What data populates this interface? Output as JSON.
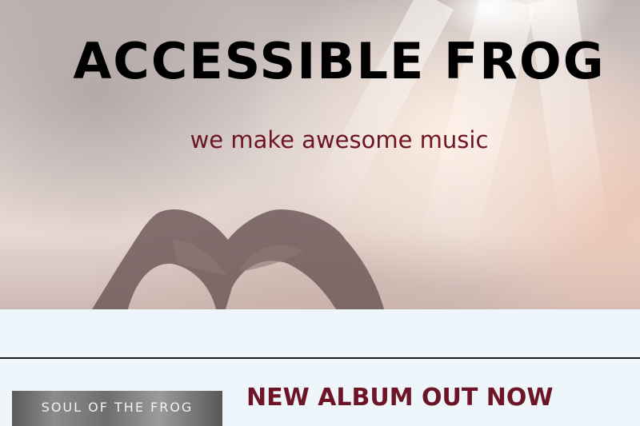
{
  "hero": {
    "title": "ACCESSIBLE FROG",
    "tagline": "we make awesome music"
  },
  "album": {
    "cover_text": "SOUL OF THE FROG",
    "heading": "NEW ALBUM OUT NOW"
  },
  "colors": {
    "accent": "#6d1527",
    "title": "#000000",
    "page_background": "#eef6fb"
  }
}
